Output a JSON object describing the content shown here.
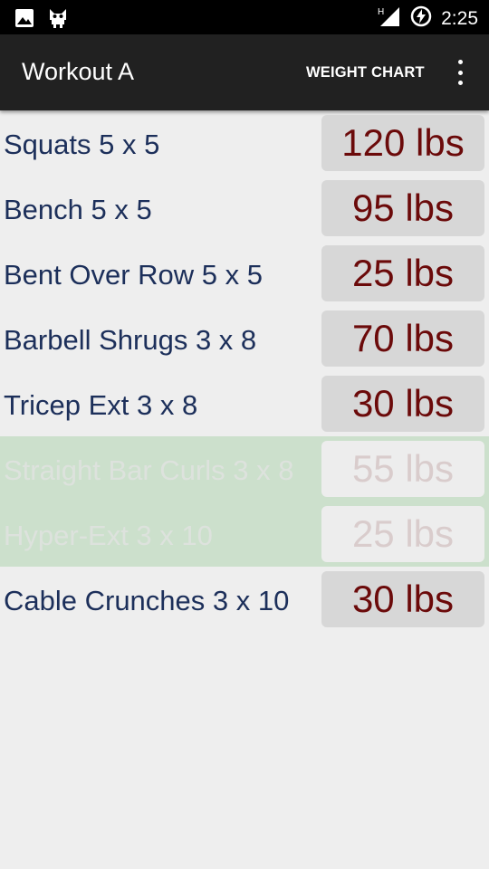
{
  "status_bar": {
    "icons_left": [
      "image-icon",
      "cat-notification-icon"
    ],
    "network_label": "H",
    "time": "2:25"
  },
  "app_bar": {
    "title": "Workout A",
    "action_label": "WEIGHT CHART",
    "menu_icon": "overflow-menu-icon"
  },
  "exercises": [
    {
      "name": "Squats 5 x 5",
      "weight": "120 lbs",
      "done": false
    },
    {
      "name": "Bench 5 x 5",
      "weight": "95 lbs",
      "done": false
    },
    {
      "name": "Bent Over Row 5 x 5",
      "weight": "25 lbs",
      "done": false
    },
    {
      "name": "Barbell Shrugs 3 x 8",
      "weight": "70 lbs",
      "done": false
    },
    {
      "name": "Tricep Ext 3 x 8",
      "weight": "30 lbs",
      "done": false
    },
    {
      "name": "Straight Bar Curls 3 x 8",
      "weight": "55 lbs",
      "done": true
    },
    {
      "name": "Hyper-Ext 3 x 10",
      "weight": "25 lbs",
      "done": true
    },
    {
      "name": "Cable Crunches 3 x 10",
      "weight": "30 lbs",
      "done": false
    }
  ],
  "colors": {
    "app_bar": "#212121",
    "exercise_text": "#1c2f5a",
    "weight_text": "#6b0a0a",
    "done_row": "#cce0cc"
  }
}
